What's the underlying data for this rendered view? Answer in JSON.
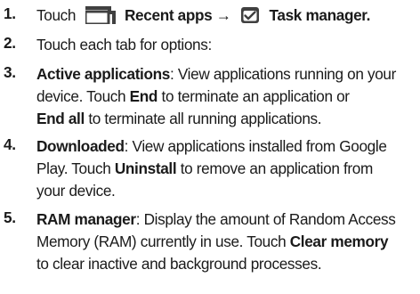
{
  "steps": [
    {
      "number": "1.",
      "touch": "Touch",
      "recent_apps": "Recent apps",
      "arrow": "→",
      "task_manager": "Task manager."
    },
    {
      "number": "2.",
      "text": "Touch each tab for options:"
    },
    {
      "number": "3.",
      "term": "Active applications",
      "line1_rest": ": View applications running on your",
      "line2_a": "device. Touch ",
      "end": "End",
      "line2_b": " to terminate an application or",
      "end_all": "End all",
      "line3_b": " to terminate all running applications."
    },
    {
      "number": "4.",
      "term": "Downloaded",
      "line1_rest": ": View applications installed from Google",
      "line2_a": "Play. Touch ",
      "uninstall": "Uninstall",
      "line2_b": " to remove an application from",
      "line3": "your device."
    },
    {
      "number": "5.",
      "term": "RAM manager",
      "line1_rest": ": Display the amount of Random Access",
      "line2_a": "Memory (RAM) currently in use. Touch ",
      "clear_memory": "Clear memory",
      "line3": "to clear inactive and background processes."
    }
  ],
  "icons": {
    "recent_apps": "recent-apps-icon",
    "task_manager": "task-manager-icon"
  },
  "colors": {
    "text": "#1a1a1a",
    "icon_fill": "#404040"
  }
}
